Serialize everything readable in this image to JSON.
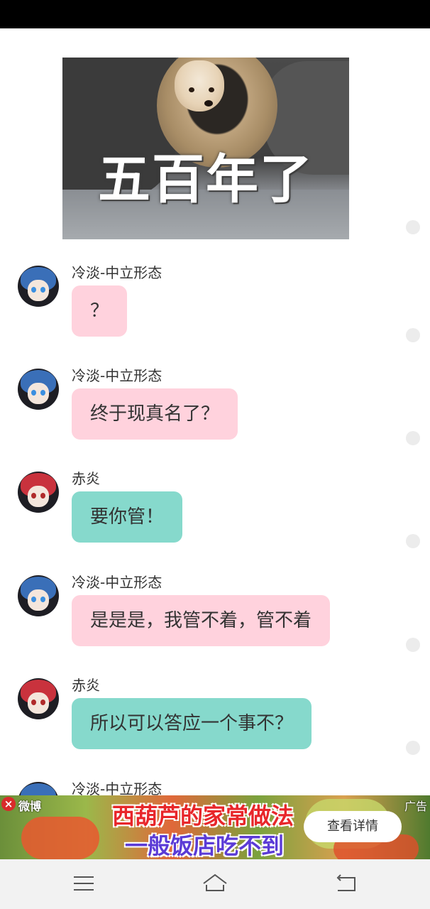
{
  "meme": {
    "caption": "五百年了"
  },
  "messages": [
    {
      "sender": "冷淡-中立形态",
      "text": "？",
      "color": "pink"
    },
    {
      "sender": "冷淡-中立形态",
      "text": "终于现真名了？",
      "color": "pink"
    },
    {
      "sender": "赤炎",
      "text": "要你管！",
      "color": "teal"
    },
    {
      "sender": "冷淡-中立形态",
      "text": "是是是，我管不着，管不着",
      "color": "pink"
    },
    {
      "sender": "赤炎",
      "text": "所以可以答应一个事不？",
      "color": "teal"
    },
    {
      "sender": "冷淡-中立形态",
      "text": "",
      "color": "pink"
    }
  ],
  "ad": {
    "brand": "微博",
    "tag": "广告",
    "headline1": "西葫芦的家常做法",
    "headline2": "一般饭店吃不到",
    "cta": "查看详情"
  },
  "nav": {
    "items": [
      "menu-icon",
      "home-icon",
      "back-icon"
    ]
  },
  "colors": {
    "pink_bubble": "#ffd2dd",
    "teal_bubble": "#86d9cc"
  }
}
